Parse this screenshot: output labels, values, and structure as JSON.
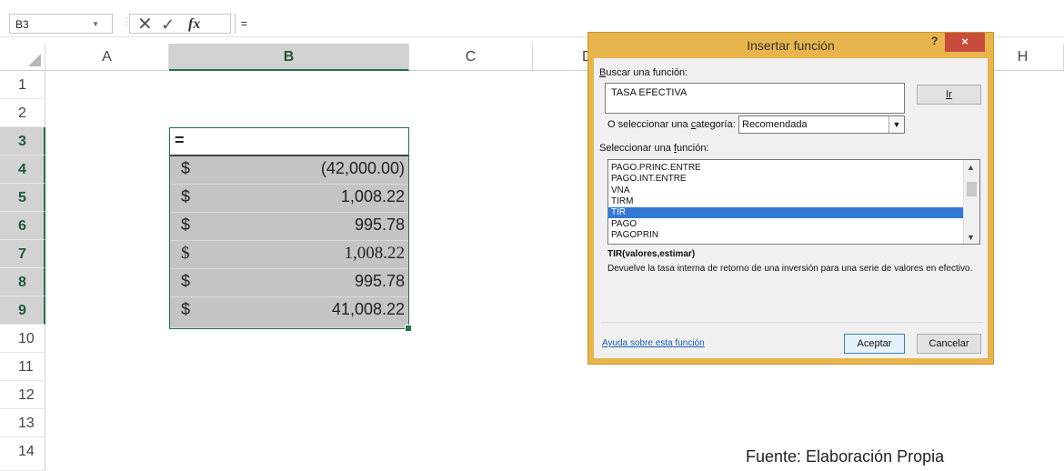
{
  "formula_bar": {
    "name_box": "B3",
    "cancel_symbol": "✕",
    "enter_symbol": "✓",
    "fx_label": "fx",
    "content": "="
  },
  "columns": [
    "A",
    "B",
    "C",
    "D",
    "H"
  ],
  "selected_column": "B",
  "rows": [
    "1",
    "2",
    "3",
    "4",
    "5",
    "6",
    "7",
    "8",
    "9",
    "10",
    "11",
    "12",
    "13",
    "14"
  ],
  "cells": {
    "b3": "=",
    "data": [
      {
        "currency": "$",
        "value": "(42,000.00)"
      },
      {
        "currency": "$",
        "value": "1,008.22"
      },
      {
        "currency": "$",
        "value": "995.78"
      },
      {
        "currency": "$",
        "value": "1,008.22"
      },
      {
        "currency": "$",
        "value": "995.78"
      },
      {
        "currency": "$",
        "value": "41,008.22"
      }
    ]
  },
  "dialog": {
    "title": "Insertar función",
    "help_label": "?",
    "close_label": "×",
    "search_label_u": "B",
    "search_label_rest": "uscar una función:",
    "search_value": "TASA EFECTIVA",
    "go_button": "Ir",
    "category_label_pre": "O seleccionar una ",
    "category_label_u": "c",
    "category_label_post": "ategoría:",
    "category_value": "Recomendada",
    "function_label_pre": "Seleccionar una ",
    "function_label_u": "f",
    "function_label_post": "unción:",
    "functions": [
      "PAGO.PRINC.ENTRE",
      "PAGO.INT.ENTRE",
      "VNA",
      "TIRM",
      "TIR",
      "PAGO",
      "PAGOPRIN"
    ],
    "selected_function": "TIR",
    "syntax": "TIR(valores,estimar)",
    "description": "Devuelve la tasa interna de retorno de una inversión para una serie de valores en efectivo.",
    "help_link": "Ayuda sobre esta función",
    "ok_button": "Aceptar",
    "cancel_button": "Cancelar"
  },
  "caption": "Fuente: Elaboración Propia"
}
